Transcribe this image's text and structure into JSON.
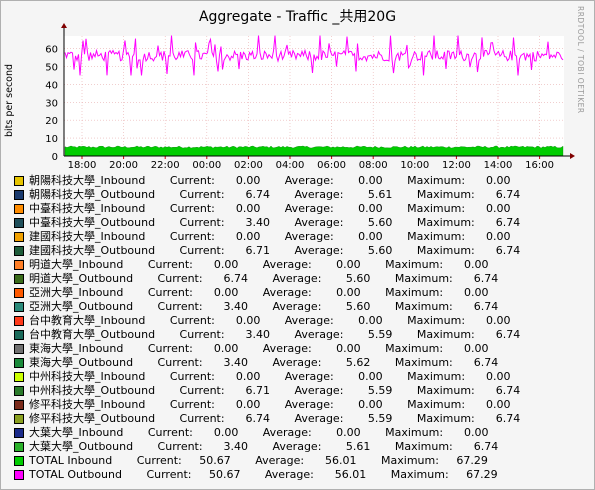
{
  "watermark": "RRDTOOL / TOBI OETIKER",
  "chart_data": {
    "type": "line",
    "title": "Aggregate - Traffic _共用20G",
    "ylabel": "bits per second",
    "xlabel": "",
    "x_ticks": [
      "18:00",
      "20:00",
      "22:00",
      "00:00",
      "02:00",
      "04:00",
      "06:00",
      "08:00",
      "10:00",
      "12:00",
      "14:00",
      "16:00"
    ],
    "y_ticks": [
      0,
      10,
      20,
      30,
      40,
      50,
      60
    ],
    "ylim": [
      0,
      67
    ],
    "grid": true,
    "series": [
      {
        "name": "TOTAL Outbound",
        "color": "#ff00ff",
        "style": "line",
        "approx_level": 56,
        "min": 45,
        "max": 67.29,
        "current": 50.67
      },
      {
        "name": "TOTAL Inbound",
        "color": "#00cc00",
        "style": "area",
        "approx_level": 5,
        "current": 50.67
      }
    ]
  },
  "legend": [
    {
      "color": "#e6c400",
      "text": "朝陽科技大學_Inbound       Current:      0.00       Average:       0.00       Maximum:      0.00"
    },
    {
      "color": "#1a3a6e",
      "text": "朝陽科技大學_Outbound       Current:      6.74       Average:       5.61       Maximum:      6.74"
    },
    {
      "color": "#ff8c00",
      "text": "中臺科技大學_Inbound       Current:      0.00       Average:       0.00       Maximum:      0.00"
    },
    {
      "color": "#1f4f5a",
      "text": "中臺科技大學_Outbound       Current:      3.40       Average:       5.60       Maximum:      6.74"
    },
    {
      "color": "#f0a000",
      "text": "建國科技大學_Inbound       Current:      0.00       Average:       0.00       Maximum:      0.00"
    },
    {
      "color": "#1e5c3a",
      "text": "建國科技大學_Outbound       Current:      6.71       Average:       5.60       Maximum:      6.74"
    },
    {
      "color": "#ff7f27",
      "text": "明道大學_Inbound       Current:      0.00       Average:       0.00       Maximum:      0.00"
    },
    {
      "color": "#3a6b1a",
      "text": "明道大學_Outbound       Current:      6.74       Average:       5.60       Maximum:      6.74"
    },
    {
      "color": "#ff5a00",
      "text": "亞洲大學_Inbound       Current:      0.00       Average:       0.00       Maximum:      0.00"
    },
    {
      "color": "#2a8a7a",
      "text": "亞洲大學_Outbound       Current:      3.40       Average:       5.60       Maximum:      6.74"
    },
    {
      "color": "#ff3a1a",
      "text": "台中教育大學_Inbound       Current:      0.00       Average:       0.00       Maximum:      0.00"
    },
    {
      "color": "#1a6a5a",
      "text": "台中教育大學_Outbound       Current:      3.40       Average:       5.59       Maximum:      6.74"
    },
    {
      "color": "#707070",
      "text": "東海大學_Inbound       Current:      0.00       Average:       0.00       Maximum:      0.00"
    },
    {
      "color": "#1a8a3a",
      "text": "東海大學_Outbound       Current:      3.40       Average:       5.62       Maximum:      6.74"
    },
    {
      "color": "#ccff00",
      "text": "中州科技大學_Inbound       Current:      0.00       Average:       0.00       Maximum:      0.00"
    },
    {
      "color": "#2a7a2a",
      "text": "中州科技大學_Outbound       Current:      6.71       Average:       5.59       Maximum:      6.74"
    },
    {
      "color": "#7a2a1a",
      "text": "修平科技大學_Inbound       Current:      0.00       Average:       0.00       Maximum:      0.00"
    },
    {
      "color": "#8aa020",
      "text": "修平科技大學_Outbound       Current:      6.74       Average:       5.59       Maximum:      6.74"
    },
    {
      "color": "#1a2a8a",
      "text": "大葉大學_Inbound       Current:      0.00       Average:       0.00       Maximum:      0.00"
    },
    {
      "color": "#2ab02a",
      "text": "大葉大學_Outbound       Current:      3.40       Average:       5.61       Maximum:      6.74"
    },
    {
      "color": "#00cc00",
      "text": "TOTAL Inbound       Current:     50.67       Average:      56.01       Maximum:     67.29"
    },
    {
      "color": "#ff00ff",
      "text": "TOTAL Outbound       Current:     50.67       Average:      56.01       Maximum:     67.29"
    }
  ]
}
